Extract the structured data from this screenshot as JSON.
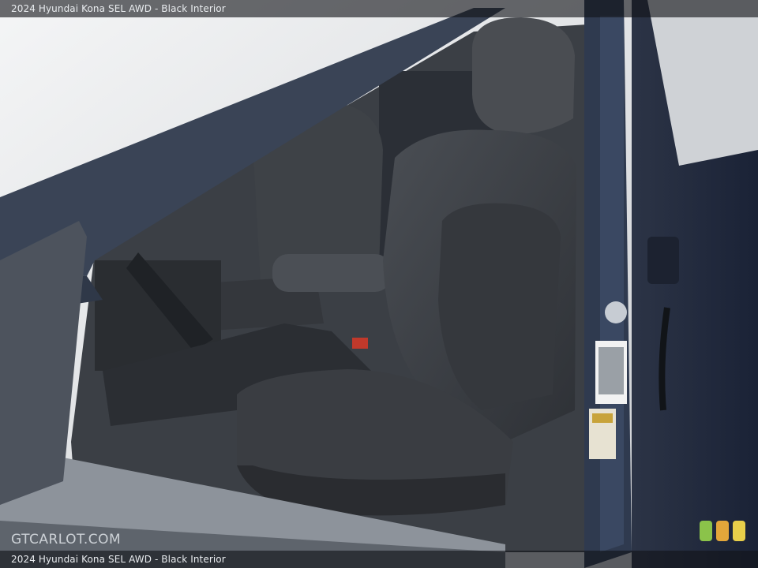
{
  "caption": {
    "top": "2024 Hyundai Kona SEL AWD - Black Interior",
    "bottom": "2024 Hyundai Kona SEL AWD - Black Interior"
  },
  "watermark": {
    "text": "GTCARLOT.COM"
  },
  "badges": {
    "colors": [
      "#8bc34a",
      "#e3a63a",
      "#e8cf4a"
    ]
  },
  "scene": {
    "subject": "front-seat-interior",
    "colors": {
      "upholstery": "#3a3d42",
      "door-frame": "#2f3a4f",
      "exterior-paint": "#1d2a44"
    }
  }
}
